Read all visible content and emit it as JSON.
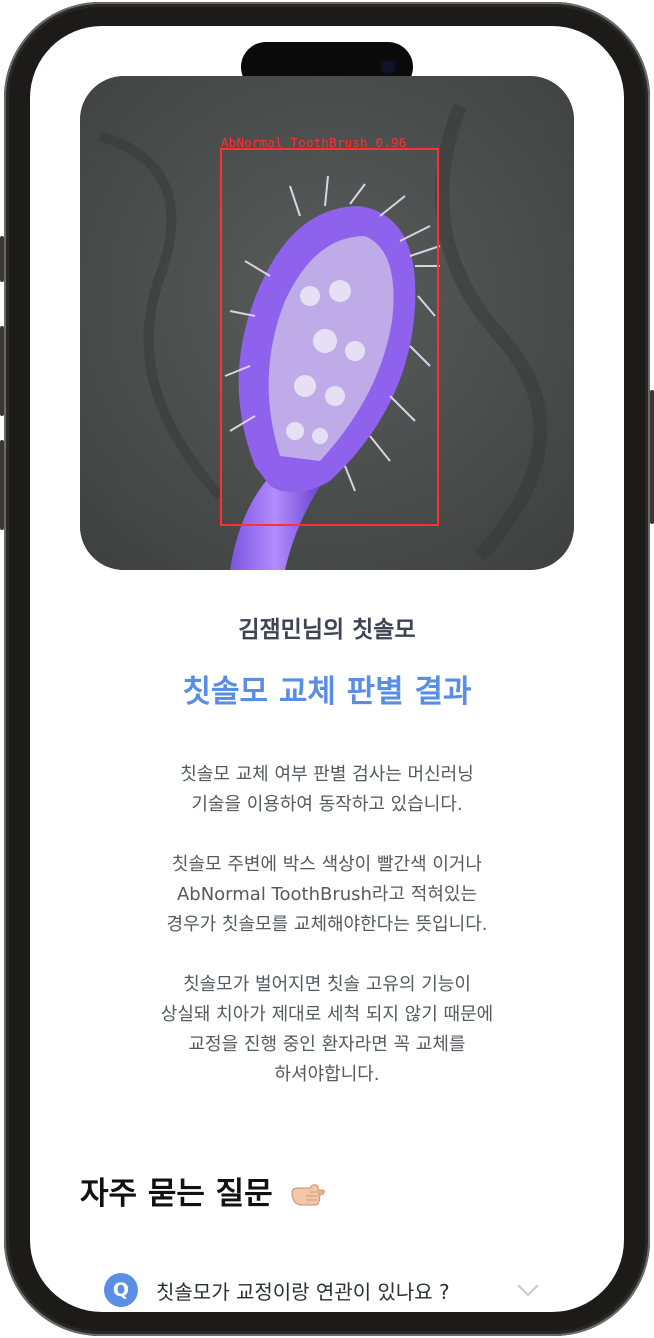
{
  "result_image": {
    "detection_label": "AbNormal ToothBrush 0.96"
  },
  "owner_title": "김잼민님의 칫솔모",
  "result_title": "칫솔모 교체 판별 결과",
  "description": {
    "p1_line1": "칫솔모 교체 여부 판별 검사는 머신러닝",
    "p1_line2": "기술을 이용하여 동작하고 있습니다.",
    "p2_line1": "칫솔모 주변에 박스 색상이 빨간색 이거나",
    "p2_line2": "AbNormal ToothBrush라고 적혀있는",
    "p2_line3": "경우가 칫솔모를 교체해야한다는 뜻입니다.",
    "p3_line1": "칫솔모가 벌어지면 칫솔 고유의 기능이",
    "p3_line2": "상실돼 치아가 제대로 세척 되지 않기 때문에",
    "p3_line3": "교정을 진행 중인 환자라면 꼭 교체를",
    "p3_line4": "하셔야합니다."
  },
  "faq": {
    "title": "자주 묻는 질문",
    "title_icon": "pointing-hand-icon",
    "items": [
      {
        "badge": "Q",
        "question": "칫솔모가 교정이랑 연관이 있나요 ?",
        "expand_icon": "chevron-down-icon"
      }
    ]
  },
  "colors": {
    "accent": "#5b8fe6",
    "detection_box": "#ff3030",
    "brush_bristles": "#9b6df0"
  }
}
